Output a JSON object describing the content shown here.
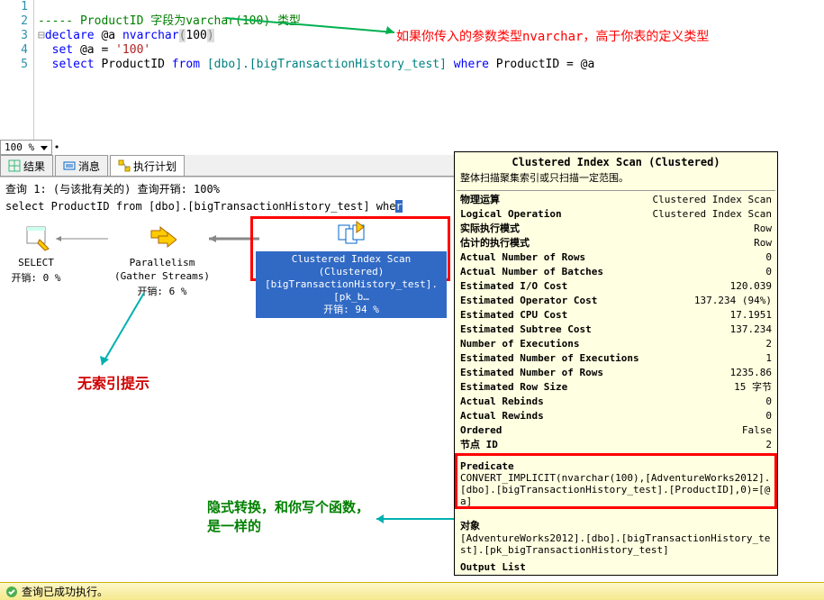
{
  "editor": {
    "lines": [
      "1",
      "2",
      "3",
      "4",
      "5"
    ],
    "l2_comment": "----- ProductID 字段为varchar(100) 类型",
    "l3_declare": "declare",
    "l3_var": " @a ",
    "l3_nvarchar": "nvarchar",
    "l3_paren": "(100)",
    "l4_set": "set",
    "l4_assign": " @a = ",
    "l4_val": "'100'",
    "l5_select": "select",
    "l5_col": " ProductID ",
    "l5_from": "from",
    "l5_obj": " [dbo].[bigTransactionHistory_test] ",
    "l5_where": "where",
    "l5_cond": " ProductID = @a"
  },
  "annotations": {
    "top_right": "如果你传入的参数类型nvarchar，高于你表的定义类型",
    "no_index": "无索引提示",
    "implicit1": "隐式转换，和你写个函数，",
    "implicit2": "是一样的"
  },
  "zoom": {
    "value": "100 %"
  },
  "tabs": {
    "results": "结果",
    "messages": "消息",
    "plan": "执行计划"
  },
  "plan": {
    "header": "查询 1: (与该批有关的) 查询开销: 100%",
    "sql": "select ProductID from [dbo].[bigTransactionHistory_test] whe",
    "sql_tail": "r",
    "select_label": "SELECT",
    "select_cost": "开销: 0 %",
    "parallel_label": "Parallelism",
    "parallel_sub": "(Gather Streams)",
    "parallel_cost": "开销: 6 %",
    "scan_l1": "Clustered Index Scan (Clustered)",
    "scan_l2": "[bigTransactionHistory_test].[pk_b…",
    "scan_l3": "开销: 94 %"
  },
  "tooltip": {
    "title": "Clustered Index Scan (Clustered)",
    "subtitle": "整体扫描聚集索引或只扫描一定范围。",
    "rows": [
      {
        "k": "物理运算",
        "v": "Clustered Index Scan"
      },
      {
        "k": "Logical Operation",
        "v": "Clustered Index Scan"
      },
      {
        "k": "实际执行模式",
        "v": "Row"
      },
      {
        "k": "估计的执行模式",
        "v": "Row"
      },
      {
        "k": "Actual Number of Rows",
        "v": "0"
      },
      {
        "k": "Actual Number of Batches",
        "v": "0"
      },
      {
        "k": "Estimated I/O Cost",
        "v": "120.039"
      },
      {
        "k": "Estimated Operator Cost",
        "v": "137.234 (94%)"
      },
      {
        "k": "Estimated CPU Cost",
        "v": "17.1951"
      },
      {
        "k": "Estimated Subtree Cost",
        "v": "137.234"
      },
      {
        "k": "Number of Executions",
        "v": "2"
      },
      {
        "k": "Estimated Number of Executions",
        "v": "1"
      },
      {
        "k": "Estimated Number of Rows",
        "v": "1235.86"
      },
      {
        "k": "Estimated Row Size",
        "v": "15 字节"
      },
      {
        "k": "Actual Rebinds",
        "v": "0"
      },
      {
        "k": "Actual Rewinds",
        "v": "0"
      },
      {
        "k": "Ordered",
        "v": "False"
      },
      {
        "k": "节点 ID",
        "v": "2"
      }
    ],
    "predicate_label": "Predicate",
    "predicate_body": "CONVERT_IMPLICIT(nvarchar(100),[AdventureWorks2012].[dbo].[bigTransactionHistory_test].[ProductID],0)=[@a]",
    "object_label": "对象",
    "object_body": "[AdventureWorks2012].[dbo].[bigTransactionHistory_test].[pk_bigTransactionHistory_test]",
    "output_label": "Output List"
  },
  "status": {
    "text": "查询已成功执行。"
  }
}
